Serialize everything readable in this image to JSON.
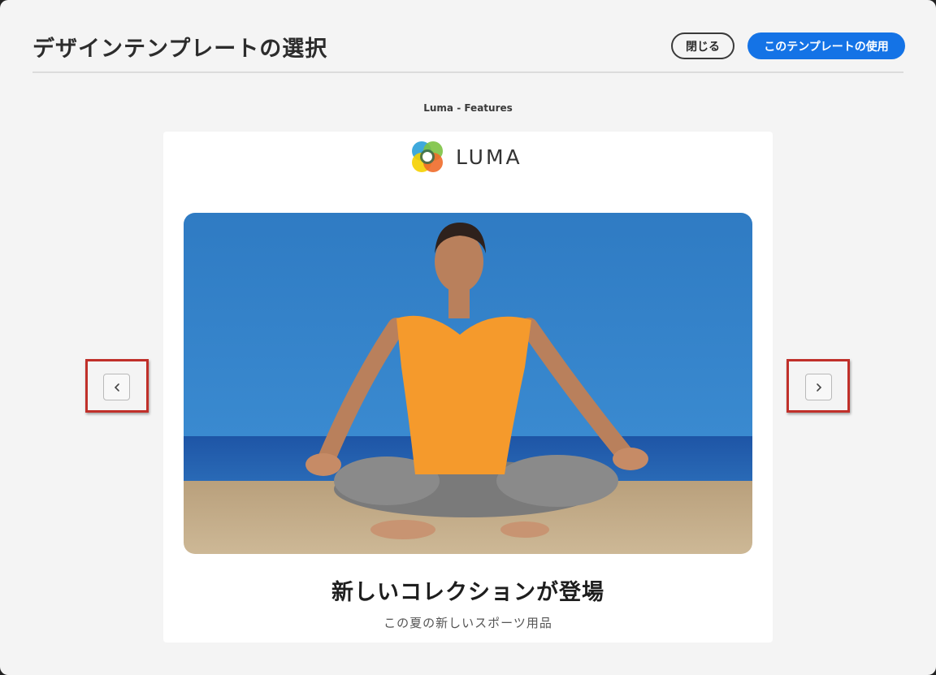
{
  "header": {
    "title": "デザインテンプレートの選択",
    "close_label": "閉じる",
    "use_label": "このテンプレートの使用"
  },
  "preview": {
    "template_name": "Luma - Features",
    "brand": "LUMA",
    "headline": "新しいコレクションが登場",
    "subheadline": "この夏の新しいスポーツ用品",
    "hero_image": "woman-meditating-on-beach"
  },
  "navigation": {
    "prev_icon": "chevron-left-icon",
    "next_icon": "chevron-right-icon"
  },
  "colors": {
    "accent": "#1473e6",
    "highlight": "#c0302a",
    "background": "#f4f4f4"
  }
}
